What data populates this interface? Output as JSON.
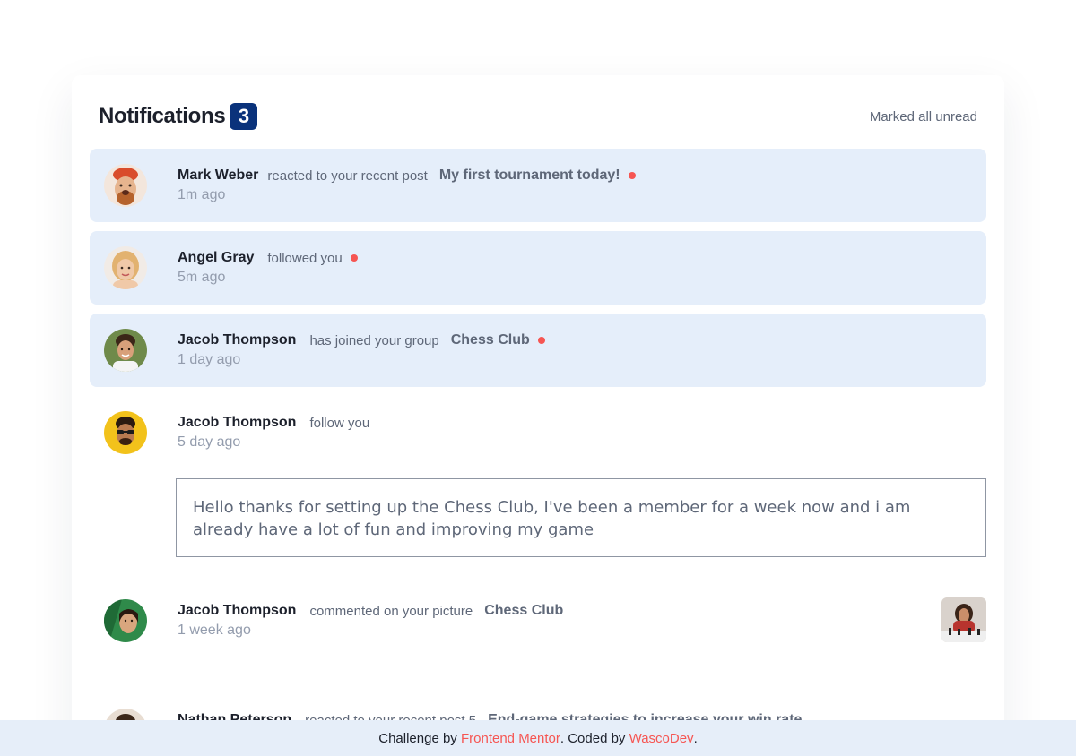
{
  "header": {
    "title": "Notifications",
    "unread_count": "3",
    "mark_all_label": "Marked all unread"
  },
  "notifications": [
    {
      "name": "Mark Weber",
      "action": "reacted to your recent post",
      "target": "My first tournament today!",
      "time": "1m ago",
      "unread": true
    },
    {
      "name": "Angel Gray",
      "action": "followed you",
      "target": "",
      "time": "5m ago",
      "unread": true
    },
    {
      "name": "Jacob Thompson",
      "action": "has joined your group",
      "target": "Chess Club",
      "time": "1 day ago",
      "unread": true
    },
    {
      "name": "Jacob Thompson",
      "action": "follow you",
      "target": "",
      "time": "5 day ago",
      "unread": false,
      "message": "Hello thanks for setting up the Chess Club, I've been a member for a week now and i am already have a lot of fun and improving my game"
    },
    {
      "name": "Jacob Thompson",
      "action": "commented on your picture",
      "target": "Chess Club",
      "time": "1 week ago",
      "unread": false
    },
    {
      "name": "Nathan Peterson",
      "action": "reacted to your recent post 5",
      "target": "End-game strategies to increase your win rate",
      "time": "",
      "unread": false
    }
  ],
  "footer": {
    "prefix": "Challenge by ",
    "link1": "Frontend Mentor",
    "middle": ". Coded by ",
    "link2": "WascoDev",
    "suffix": "."
  },
  "colors": {
    "unread_bg": "#e5eefa",
    "badge": "#0a327b",
    "dot": "#f65552",
    "footer_bg": "#e6eef9"
  }
}
